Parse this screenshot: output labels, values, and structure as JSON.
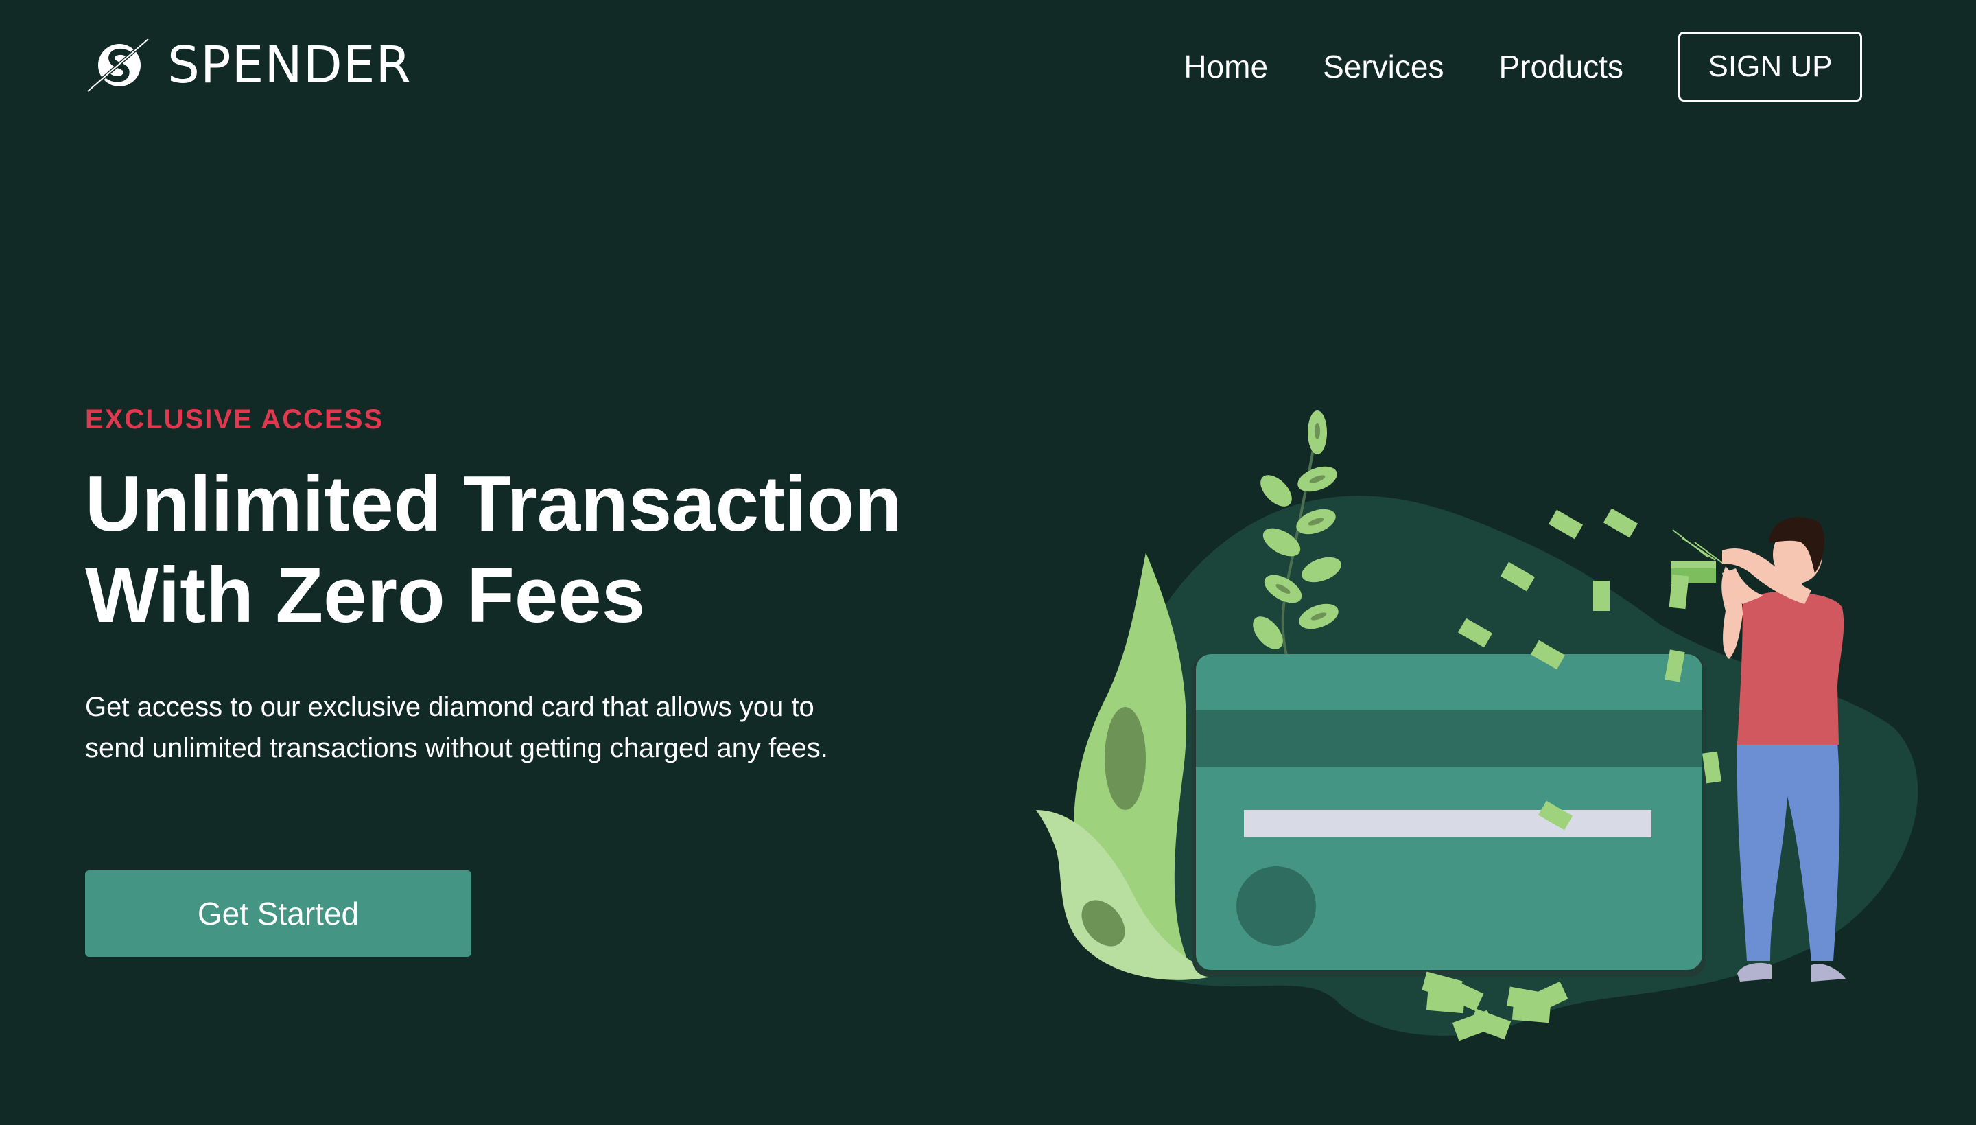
{
  "brand": {
    "name": "SPENDER",
    "logo_icon": "spender-s-logo-icon"
  },
  "nav": {
    "links": [
      {
        "label": "Home"
      },
      {
        "label": "Services"
      },
      {
        "label": "Products"
      }
    ],
    "signup_label": "SIGN UP"
  },
  "hero": {
    "eyebrow": "EXCLUSIVE ACCESS",
    "headline_line1": "Unlimited Transaction",
    "headline_line2": "With Zero Fees",
    "description": "Get access to our exclusive diamond card that allows you to send unlimited transactions without getting charged any fees.",
    "cta_label": "Get Started"
  },
  "illustration": {
    "name": "person-with-credit-card-illustration"
  },
  "colors": {
    "background": "#122a26",
    "accent": "#e0394f",
    "button": "#449584",
    "card": "#449584",
    "card_stripe": "#2f6d61",
    "leaf_light": "#a3d47d",
    "shirt": "#d0585e",
    "jeans": "#6c8fd4"
  }
}
